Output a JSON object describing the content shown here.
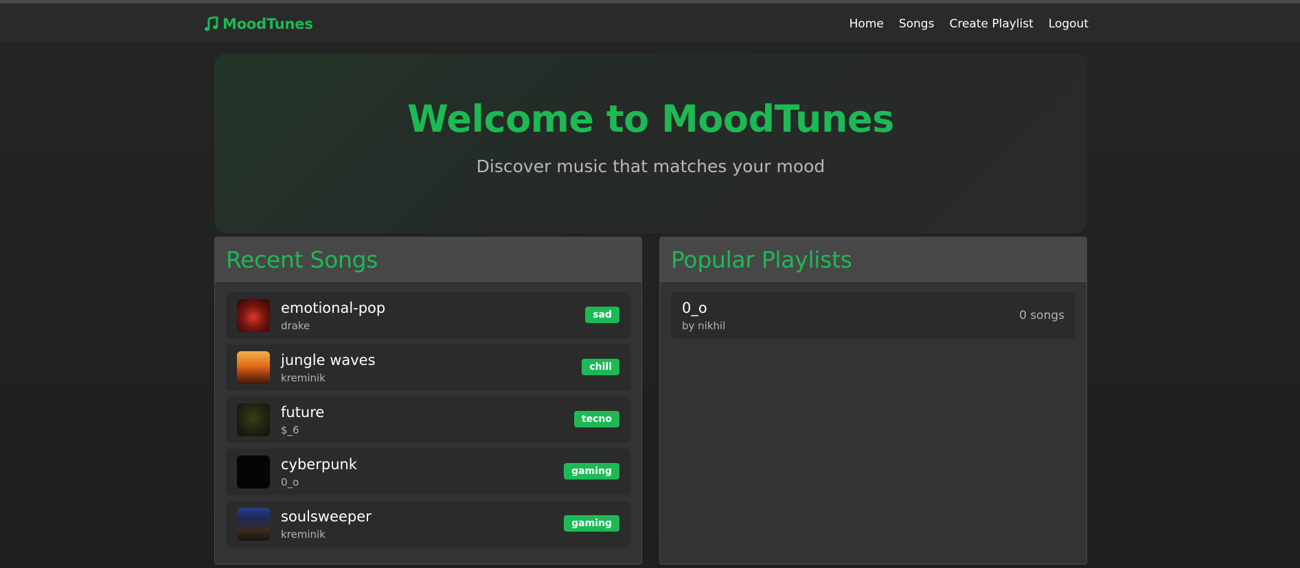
{
  "app": {
    "brand": "MoodTunes",
    "accent_color": "#1db954",
    "brand_icon": "music-note-icon"
  },
  "nav": {
    "items": [
      {
        "label": "Home"
      },
      {
        "label": "Songs"
      },
      {
        "label": "Create Playlist"
      },
      {
        "label": "Logout"
      }
    ]
  },
  "hero": {
    "title": "Welcome to MoodTunes",
    "subtitle": "Discover music that matches your mood"
  },
  "recent_songs": {
    "heading": "Recent Songs",
    "items": [
      {
        "title": "emotional-pop",
        "artist": "drake",
        "mood": "sad"
      },
      {
        "title": "jungle waves",
        "artist": "kreminik",
        "mood": "chill"
      },
      {
        "title": "future",
        "artist": "$_6",
        "mood": "tecno"
      },
      {
        "title": "cyberpunk",
        "artist": "0_o",
        "mood": "gaming"
      },
      {
        "title": "soulsweeper",
        "artist": "kreminik",
        "mood": "gaming"
      }
    ]
  },
  "popular_playlists": {
    "heading": "Popular Playlists",
    "items": [
      {
        "name": "0_o",
        "owner": "by nikhil",
        "count": "0 songs"
      }
    ]
  }
}
